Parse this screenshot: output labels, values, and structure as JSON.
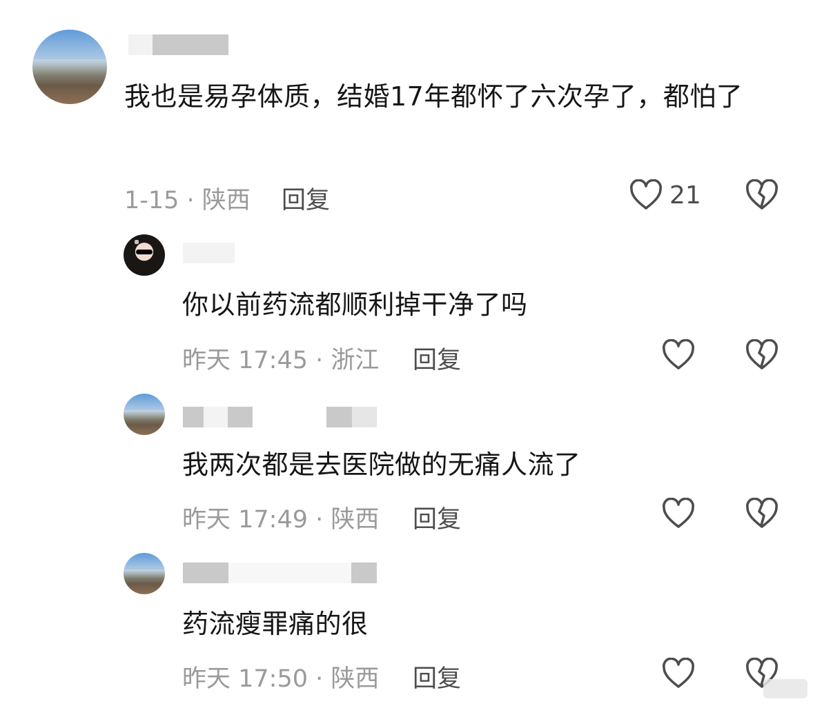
{
  "comments": [
    {
      "text": "我也是易孕体质，结婚17年都怀了六次孕了，都怕了",
      "meta": "1-15 · 陕西",
      "reply": "回复",
      "likes": "21"
    },
    {
      "text": "你以前药流都顺利掉干净了吗",
      "meta": "昨天 17:45 · 浙江",
      "reply": "回复"
    },
    {
      "text": "我两次都是去医院做的无痛人流了",
      "meta": "昨天 17:49 · 陕西",
      "reply": "回复"
    },
    {
      "text": "药流瘦罪痛的很",
      "meta": "昨天 17:50 · 陕西",
      "reply": "回复"
    }
  ],
  "icons": {
    "like": "heart-outline-icon",
    "dislike": "broken-heart-icon"
  },
  "colors": {
    "text": "#161616",
    "meta": "#9a9a9a",
    "action": "#4d4d4d"
  }
}
